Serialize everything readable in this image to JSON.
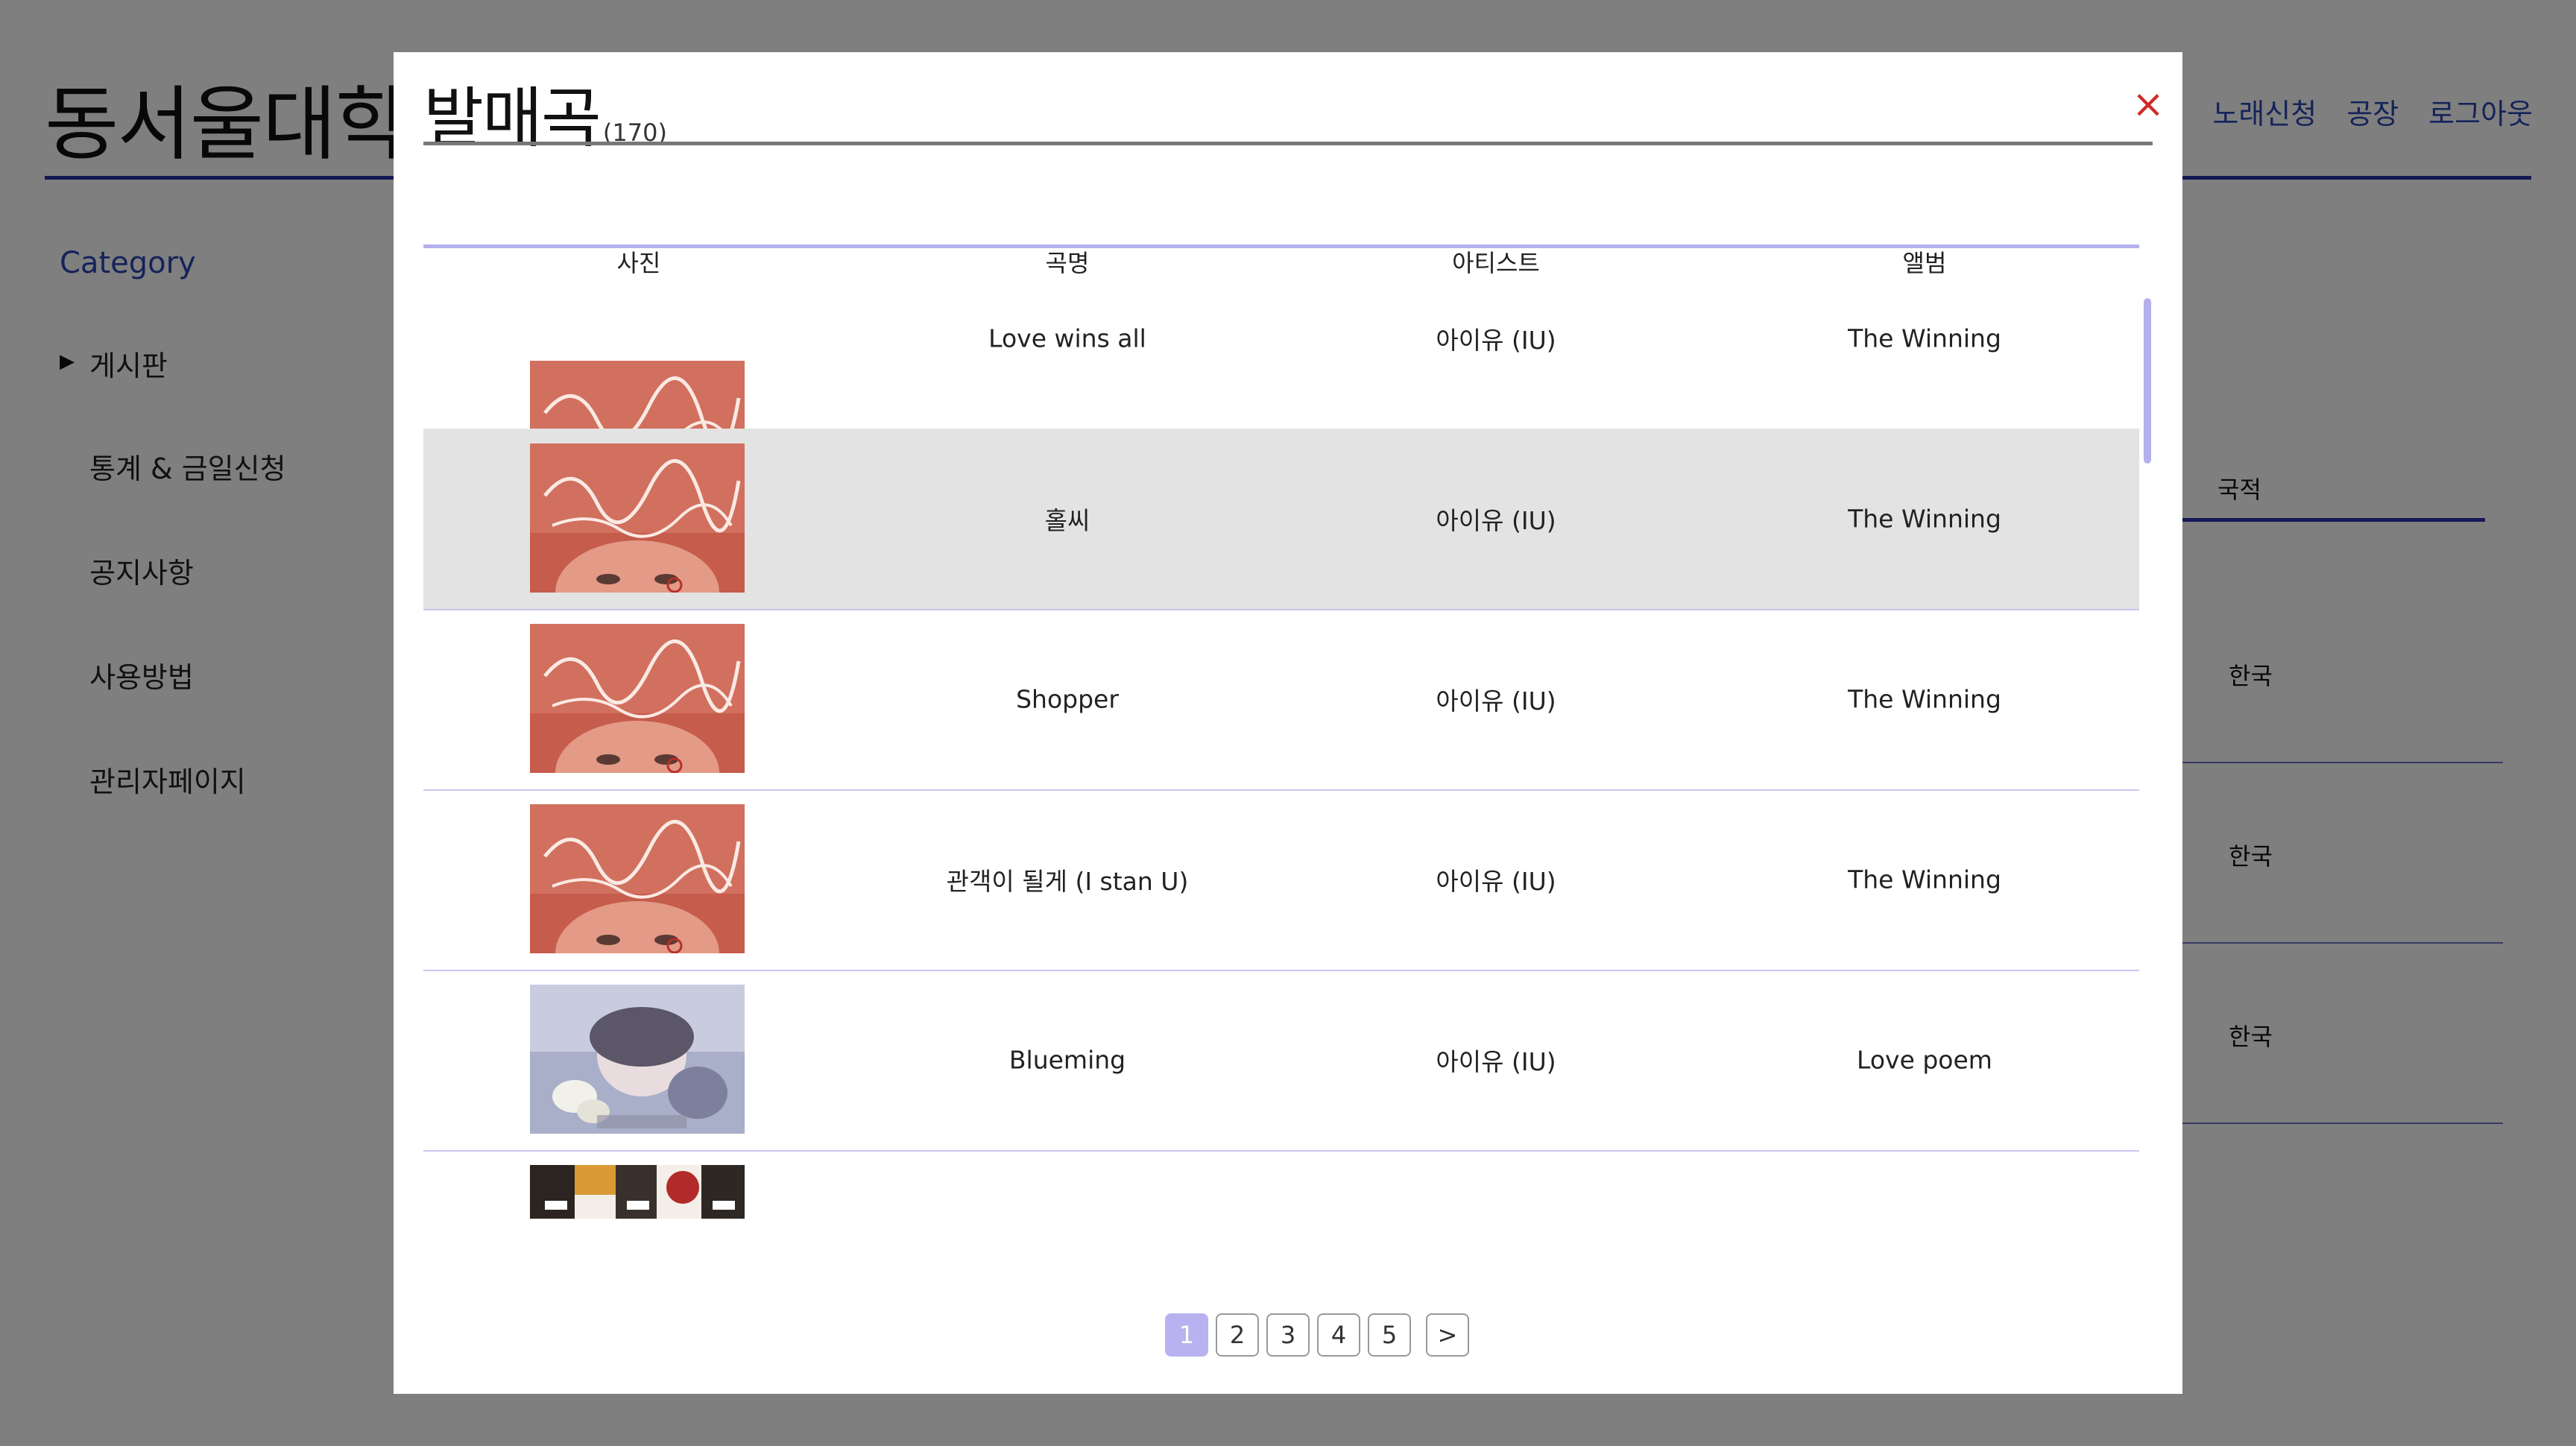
{
  "site": {
    "title": "동서울대학교",
    "nav": [
      "노래신청",
      "공장",
      "로그아웃"
    ]
  },
  "sidebar": {
    "category_label": "Category",
    "items": [
      {
        "label": "게시판"
      },
      {
        "label": "통계 & 금일신청"
      },
      {
        "label": "공지사항"
      },
      {
        "label": "사용방법"
      },
      {
        "label": "관리자페이지"
      }
    ]
  },
  "background_table": {
    "column_header": "국적",
    "cells": [
      "한국",
      "한국",
      "한국"
    ]
  },
  "modal": {
    "title": "발매곡",
    "count": "(170)",
    "close_label": "×",
    "columns": [
      "사진",
      "곡명",
      "아티스트",
      "앨범"
    ],
    "rows": [
      {
        "title": "Love wins all",
        "artist": "아이유 (IU)",
        "album": "The Winning",
        "thumb": "the-winning-cover"
      },
      {
        "title": "홀씨",
        "artist": "아이유 (IU)",
        "album": "The Winning",
        "thumb": "the-winning-cover"
      },
      {
        "title": "Shopper",
        "artist": "아이유 (IU)",
        "album": "The Winning",
        "thumb": "the-winning-cover"
      },
      {
        "title": "관객이 될게 (I stan U)",
        "artist": "아이유 (IU)",
        "album": "The Winning",
        "thumb": "the-winning-cover"
      },
      {
        "title": "Blueming",
        "artist": "아이유 (IU)",
        "album": "Love poem",
        "thumb": "love-poem-cover"
      },
      {
        "title": "",
        "artist": "",
        "album": "",
        "thumb": "group-photo-cover"
      }
    ],
    "pagination": {
      "pages": [
        "1",
        "2",
        "3",
        "4",
        "5"
      ],
      "current": "1",
      "next_label": ">"
    }
  },
  "colors": {
    "accent": "#2b46b4",
    "header_rule": "#2b33a8",
    "table_rule": "#b5b0ec",
    "row_highlight": "#e3e3e3",
    "pager_active": "#b9b2f0",
    "close": "#d02a2a"
  }
}
